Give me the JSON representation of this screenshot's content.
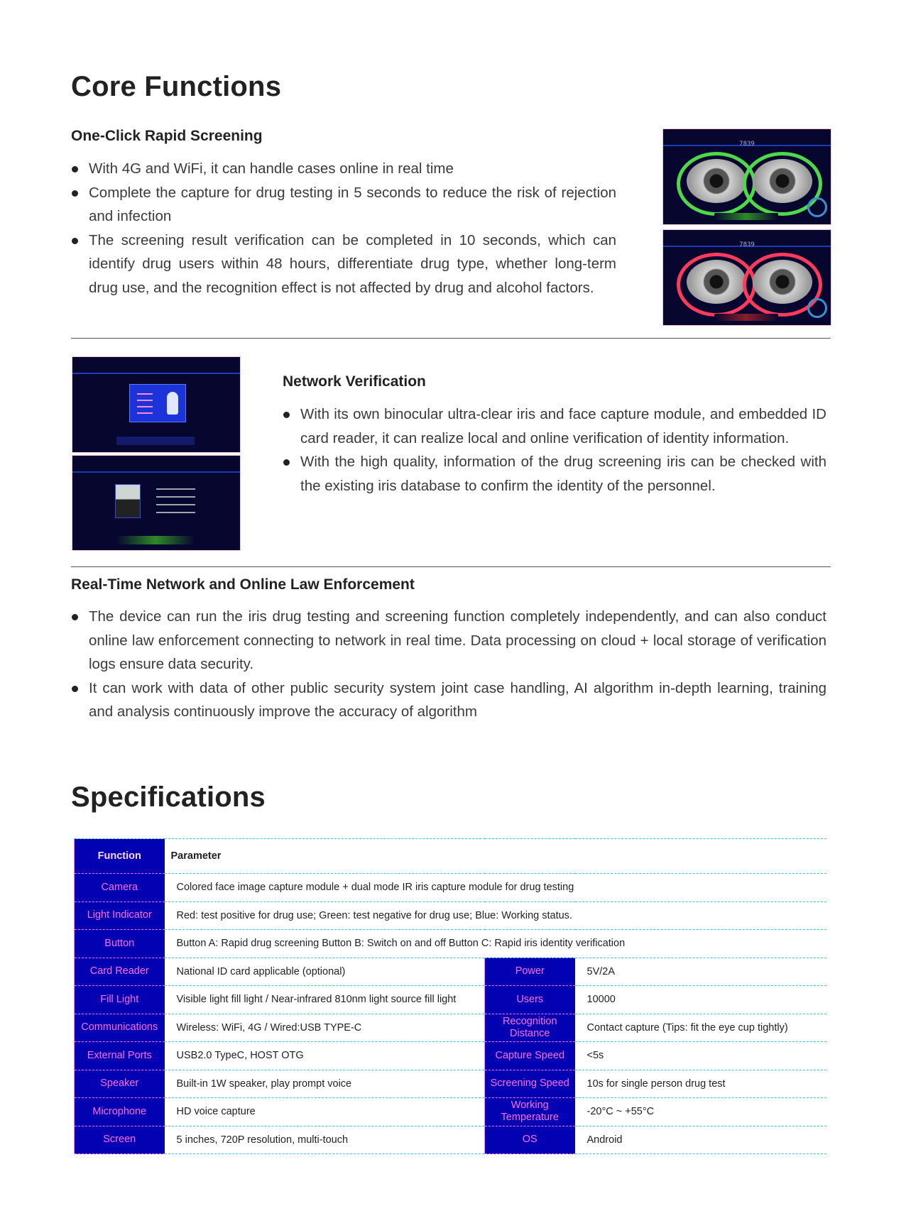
{
  "core": {
    "title": "Core Functions",
    "one_click": {
      "heading": "One-Click Rapid Screening",
      "bullets": [
        "With 4G and WiFi, it can handle cases online in real time",
        "Complete the capture for drug testing in 5 seconds to reduce the risk of rejection and infection",
        "The screening result verification can be completed in 10 seconds, which can identify drug users within 48 hours, differentiate drug type, whether long-term drug use, and the recognition effect is not affected by drug and alcohol factors."
      ],
      "screen_code": "7839"
    },
    "network": {
      "heading": "Network Verification",
      "bullets": [
        "With its own binocular ultra-clear iris and face capture module, and embedded ID card reader, it can realize local and online verification of identity information.",
        "With the high quality, information of the drug screening iris can be checked with the existing iris database to confirm the identity of the personnel."
      ]
    },
    "realtime": {
      "heading": "Real-Time Network and Online Law Enforcement",
      "bullets": [
        "The device can run the iris drug testing and screening function completely independently, and can also conduct online law enforcement connecting to network in real time. Data processing on cloud + local storage of verification logs ensure data security.",
        "It can work with data of other public security system joint case handling, AI algorithm in-depth learning, training and analysis continuously improve the accuracy of algorithm"
      ]
    }
  },
  "specs": {
    "title": "Specifications",
    "header": {
      "function": "Function",
      "parameter": "Parameter"
    },
    "full_rows": [
      {
        "label": "Camera",
        "value": "Colored face image capture module + dual mode IR iris capture module for drug testing"
      },
      {
        "label": "Light Indicator",
        "value": "Red: test positive for drug use;    Green: test negative for drug use;    Blue: Working status."
      },
      {
        "label": "Button",
        "value": "Button A: Rapid drug screening    Button B: Switch on and off    Button C: Rapid iris identity verification"
      }
    ],
    "split_rows": [
      {
        "label": "Card Reader",
        "value": "National ID card applicable (optional)",
        "label2": "Power",
        "value2": "5V/2A"
      },
      {
        "label": "Fill Light",
        "value": "Visible light fill light / Near-infrared 810nm light source fill light",
        "label2": "Users",
        "value2": "10000"
      },
      {
        "label": "Communications",
        "value": "Wireless: WiFi, 4G  /  Wired:USB TYPE-C",
        "label2": "Recognition Distance",
        "value2": "Contact capture (Tips: fit the eye cup tightly)"
      },
      {
        "label": "External Ports",
        "value": "USB2.0 TypeC,  HOST OTG",
        "label2": "Capture Speed",
        "value2": "<5s"
      },
      {
        "label": "Speaker",
        "value": "Built-in 1W speaker, play prompt voice",
        "label2": "Screening Speed",
        "value2": "10s for single person drug test"
      },
      {
        "label": "Microphone",
        "value": "HD voice capture",
        "label2": "Working Temperature",
        "value2": "-20°C ~ +55°C"
      },
      {
        "label": "Screen",
        "value": "5 inches, 720P  resolution, multi-touch",
        "label2": "OS",
        "value2": "Android"
      }
    ]
  },
  "colors": {
    "table_label_bg": "#0202b2",
    "table_label_text": "#ff6cf0",
    "row_divider": "#2ccaf5",
    "pass_ring": "#4fd84a",
    "fail_ring": "#ff3b5c"
  }
}
